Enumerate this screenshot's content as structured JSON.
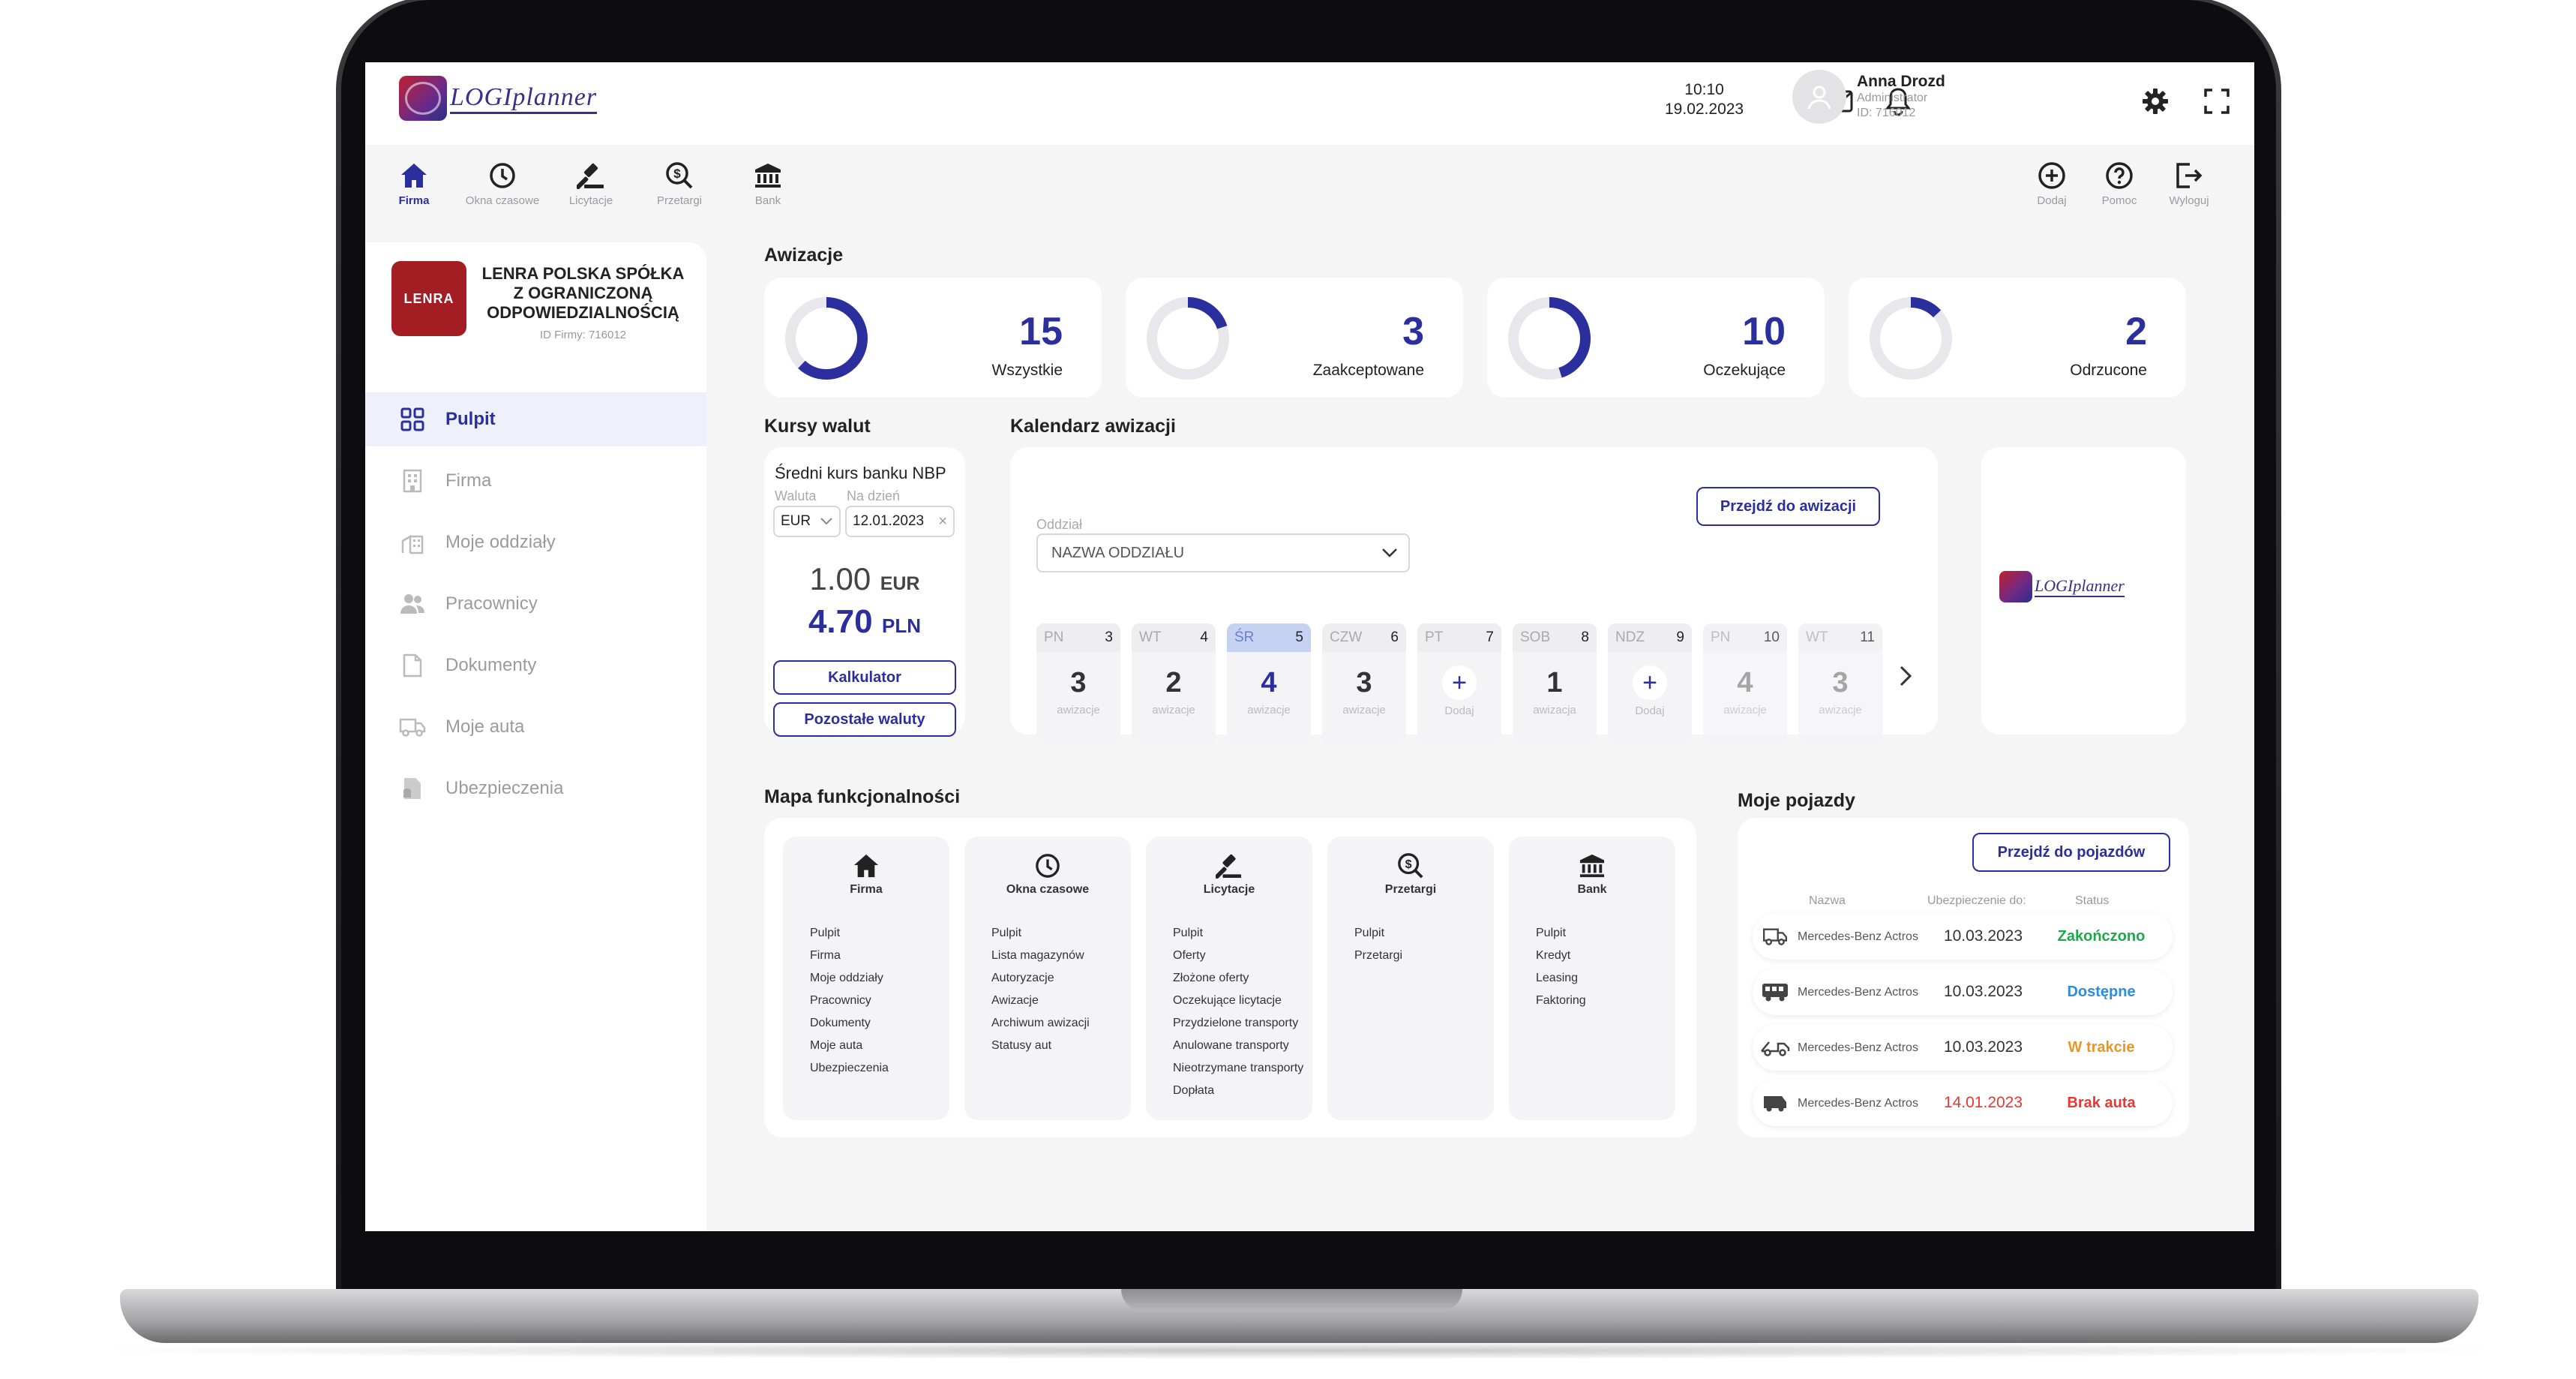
{
  "colors": {
    "accent": "#2b2f9e",
    "done": "#1fa84b",
    "available": "#2b8ddb",
    "progress": "#e8962a",
    "missing": "#e53935",
    "company_brand": "#a31e22"
  },
  "header": {
    "logo_text": "LOGIplanner",
    "time": "10:10",
    "date": "19.02.2023",
    "user": {
      "name": "Anna Drozd",
      "role": "Administrator",
      "id": "ID: 716012"
    },
    "icons": [
      "mail-icon",
      "bell-icon",
      "gear-icon",
      "fullscreen-icon"
    ]
  },
  "nav": {
    "items": [
      {
        "label": "Firma",
        "icon": "home-icon",
        "active": true
      },
      {
        "label": "Okna czasowe",
        "icon": "clock-icon"
      },
      {
        "label": "Licytacje",
        "icon": "gavel-icon"
      },
      {
        "label": "Przetargi",
        "icon": "search-dollar-icon"
      },
      {
        "label": "Bank",
        "icon": "bank-icon"
      }
    ],
    "right": [
      {
        "label": "Dodaj",
        "icon": "plus-circle-icon"
      },
      {
        "label": "Pomoc",
        "icon": "help-icon"
      },
      {
        "label": "Wyloguj",
        "icon": "logout-icon"
      }
    ]
  },
  "company": {
    "logo_text": "LENRA",
    "name": "LENRA POLSKA SPÓŁKA Z OGRANICZONĄ ODPOWIEDZIALNOŚCIĄ",
    "id": "ID Firmy: 716012"
  },
  "sidebar": {
    "items": [
      {
        "label": "Pulpit",
        "icon": "grid-icon",
        "active": true
      },
      {
        "label": "Firma",
        "icon": "building-icon"
      },
      {
        "label": "Moje oddziały",
        "icon": "branch-icon"
      },
      {
        "label": "Pracownicy",
        "icon": "users-icon"
      },
      {
        "label": "Dokumenty",
        "icon": "document-icon"
      },
      {
        "label": "Moje auta",
        "icon": "truck-icon"
      },
      {
        "label": "Ubezpieczenia",
        "icon": "insurance-icon"
      }
    ]
  },
  "awizacje": {
    "title": "Awizacje",
    "stats": [
      {
        "value": "15",
        "label": "Wszystkie",
        "fraction": 0.62
      },
      {
        "value": "3",
        "label": "Zaakceptowane",
        "fraction": 0.2
      },
      {
        "value": "10",
        "label": "Oczekujące",
        "fraction": 0.45
      },
      {
        "value": "2",
        "label": "Odrzucone",
        "fraction": 0.13
      }
    ]
  },
  "kursy": {
    "title": "Kursy walut",
    "subtitle": "Średni kurs banku NBP",
    "waluta_label": "Waluta",
    "na_dzien_label": "Na dzień",
    "currency": "EUR",
    "date": "12.01.2023",
    "amount": "1.00",
    "amount_cur": "EUR",
    "result": "4.70",
    "result_cur": "PLN",
    "btn_calc": "Kalkulator",
    "btn_other": "Pozostałe waluty"
  },
  "kalendarz": {
    "title": "Kalendarz awizacji",
    "oddzial_label": "Oddział",
    "select_value": "NAZWA ODDZIAŁU",
    "btn": "Przejdź do awizacji",
    "days": [
      {
        "dow": "PN",
        "num": "3",
        "value": "3",
        "sub": "awizacje"
      },
      {
        "dow": "WT",
        "num": "4",
        "value": "2",
        "sub": "awizacje"
      },
      {
        "dow": "ŚR",
        "num": "5",
        "value": "4",
        "sub": "awizacje",
        "selected": true
      },
      {
        "dow": "CZW",
        "num": "6",
        "value": "3",
        "sub": "awizacje"
      },
      {
        "dow": "PT",
        "num": "7",
        "value": "+",
        "sub": "Dodaj",
        "add": true
      },
      {
        "dow": "SOB",
        "num": "8",
        "value": "1",
        "sub": "awizacja"
      },
      {
        "dow": "NDZ",
        "num": "9",
        "value": "+",
        "sub": "Dodaj",
        "add": true
      },
      {
        "dow": "PN",
        "num": "10",
        "value": "4",
        "sub": "awizacje",
        "muted": true
      },
      {
        "dow": "WT",
        "num": "11",
        "value": "3",
        "sub": "awizacje",
        "muted": true
      }
    ]
  },
  "mapa": {
    "title": "Mapa funkcjonalności",
    "columns": [
      {
        "title": "Firma",
        "icon": "home-icon",
        "items": [
          "Pulpit",
          "Firma",
          "Moje oddziały",
          "Pracownicy",
          "Dokumenty",
          "Moje auta",
          "Ubezpieczenia"
        ]
      },
      {
        "title": "Okna czasowe",
        "icon": "clock-icon",
        "items": [
          "Pulpit",
          "Lista magazynów",
          "Autoryzacje",
          "Awizacje",
          "Archiwum awizacji",
          "Statusy aut"
        ]
      },
      {
        "title": "Licytacje",
        "icon": "gavel-icon",
        "items": [
          "Pulpit",
          "Oferty",
          "Złożone oferty",
          "Oczekujące licytacje",
          "Przydzielone transporty",
          "Anulowane transporty",
          "Nieotrzymane transporty",
          "Dopłata"
        ]
      },
      {
        "title": "Przetargi",
        "icon": "search-dollar-icon",
        "items": [
          "Pulpit",
          "Przetargi"
        ]
      },
      {
        "title": "Bank",
        "icon": "bank-icon",
        "items": [
          "Pulpit",
          "Kredyt",
          "Leasing",
          "Faktoring"
        ]
      }
    ]
  },
  "pojazdy": {
    "title": "Moje pojazdy",
    "btn": "Przejdź do pojazdów",
    "headers": [
      "Nazwa",
      "Ubezpieczenie do:",
      "Status"
    ],
    "rows": [
      {
        "name": "Mercedes-Benz Actros",
        "date": "10.03.2023",
        "status": "Zakończono",
        "icon": "truck-icon"
      },
      {
        "name": "Mercedes-Benz Actros",
        "date": "10.03.2023",
        "status": "Dostępne",
        "icon": "bus-icon"
      },
      {
        "name": "Mercedes-Benz Actros",
        "date": "10.03.2023",
        "status": "W trakcie",
        "icon": "tow-truck-icon"
      },
      {
        "name": "Mercedes-Benz Actros",
        "date": "14.01.2023",
        "status": "Brak auta",
        "icon": "van-icon"
      }
    ]
  }
}
